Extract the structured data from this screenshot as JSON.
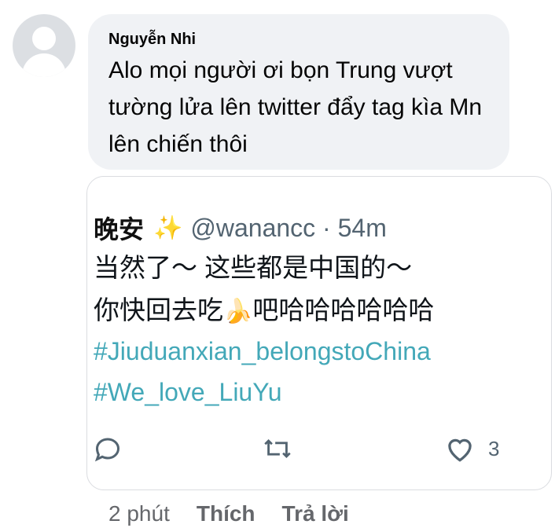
{
  "comment": {
    "author": "Nguyễn Nhi",
    "text": "Alo mọi người ơi bọn Trung vượt tường lửa lên twitter đẩy tag kìa Mn lên chiến thôi"
  },
  "tweet": {
    "name": "晚安",
    "name_emoji": "✨",
    "handle_and_time": "@wanancc · 54m",
    "line1": "当然了～ 这些都是中国的～",
    "line2_part1": "你快回去吃",
    "line2_emoji": "🍌",
    "line2_part2": "吧哈哈哈哈哈哈",
    "hashtags": [
      "#Jiuduanxian_belongstoChina",
      "#We_love_LiuYu"
    ],
    "like_count": "3",
    "icons": {
      "reply": "reply-icon",
      "retweet": "retweet-icon",
      "like": "heart-icon"
    }
  },
  "footer": {
    "time": "2 phút",
    "like_label": "Thích",
    "reply_label": "Trả lời"
  },
  "colors": {
    "bubble": "#f0f2f5",
    "hashtag": "#43a8b8",
    "meta": "#65676b"
  }
}
